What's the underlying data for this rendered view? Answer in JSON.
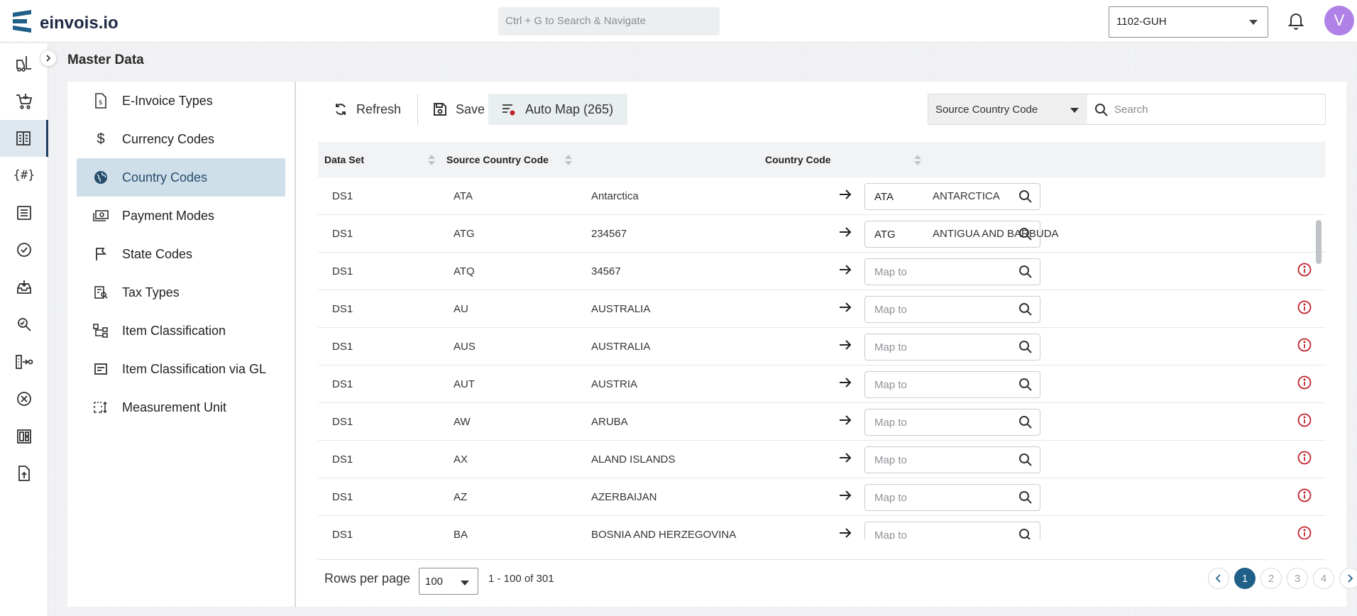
{
  "app": {
    "name": "einvois.io"
  },
  "header": {
    "search_placeholder": "Ctrl + G to Search & Navigate",
    "company_code": "1102-GUH",
    "user_initial": "V"
  },
  "rail": {
    "icons": [
      "forklift-icon",
      "cart-icon",
      "master-data-icon",
      "hashtag-icon",
      "document-list-icon",
      "check-circle-icon",
      "inbox-icon",
      "search-doc-icon",
      "flow-icon",
      "cancel-icon",
      "dashboard-icon",
      "upload-icon"
    ],
    "active_index": 2
  },
  "page": {
    "title": "Master Data"
  },
  "menu": {
    "items": [
      {
        "label": "E-Invoice Types",
        "icon": "invoice-icon"
      },
      {
        "label": "Currency Codes",
        "icon": "dollar-icon"
      },
      {
        "label": "Country Codes",
        "icon": "globe-icon"
      },
      {
        "label": "Payment Modes",
        "icon": "payment-icon"
      },
      {
        "label": "State Codes",
        "icon": "flag-icon"
      },
      {
        "label": "Tax Types",
        "icon": "tax-icon"
      },
      {
        "label": "Item Classification",
        "icon": "hierarchy-icon"
      },
      {
        "label": "Item Classification via GL",
        "icon": "ledger-icon"
      },
      {
        "label": "Measurement Unit",
        "icon": "measure-icon"
      }
    ],
    "active_index": 2
  },
  "toolbar": {
    "refresh_label": "Refresh",
    "save_label": "Save",
    "automap_label": "Auto Map (265)",
    "filter_field": "Source Country Code",
    "search_placeholder": "Search"
  },
  "grid": {
    "columns": [
      "Data Set",
      "Source Country Code",
      "Country Code"
    ],
    "rows": [
      {
        "dataset": "DS1",
        "source_code": "ATA",
        "source_name": "Antarctica",
        "mapped": "ATA",
        "mapped_name": "ANTARCTICA",
        "warning": false
      },
      {
        "dataset": "DS1",
        "source_code": "ATG",
        "source_name": "234567",
        "mapped": "ATG",
        "mapped_name": "ANTIGUA AND BARBUDA",
        "warning": false
      },
      {
        "dataset": "DS1",
        "source_code": "ATQ",
        "source_name": "34567",
        "mapped": "",
        "mapped_name": "",
        "warning": true
      },
      {
        "dataset": "DS1",
        "source_code": "AU",
        "source_name": "AUSTRALIA",
        "mapped": "",
        "mapped_name": "",
        "warning": true
      },
      {
        "dataset": "DS1",
        "source_code": "AUS",
        "source_name": "AUSTRALIA",
        "mapped": "",
        "mapped_name": "",
        "warning": true
      },
      {
        "dataset": "DS1",
        "source_code": "AUT",
        "source_name": "AUSTRIA",
        "mapped": "",
        "mapped_name": "",
        "warning": true
      },
      {
        "dataset": "DS1",
        "source_code": "AW",
        "source_name": "ARUBA",
        "mapped": "",
        "mapped_name": "",
        "warning": true
      },
      {
        "dataset": "DS1",
        "source_code": "AX",
        "source_name": "ALAND ISLANDS",
        "mapped": "",
        "mapped_name": "",
        "warning": true
      },
      {
        "dataset": "DS1",
        "source_code": "AZ",
        "source_name": "AZERBAIJAN",
        "mapped": "",
        "mapped_name": "",
        "warning": true
      },
      {
        "dataset": "DS1",
        "source_code": "BA",
        "source_name": "BOSNIA AND HERZEGOVINA",
        "mapped": "",
        "mapped_name": "",
        "warning": true
      }
    ],
    "map_placeholder": "Map to"
  },
  "footer": {
    "rows_per_page_label": "Rows per page",
    "rows_per_page": "100",
    "range_text": "1 - 100 of 301",
    "pages": [
      "1",
      "2",
      "3",
      "4"
    ],
    "current_page": "1"
  },
  "colors": {
    "brand": "#1f5f88",
    "active_bg": "#cfdfea",
    "warning": "#c0202a",
    "avatar": "#b082e8"
  }
}
